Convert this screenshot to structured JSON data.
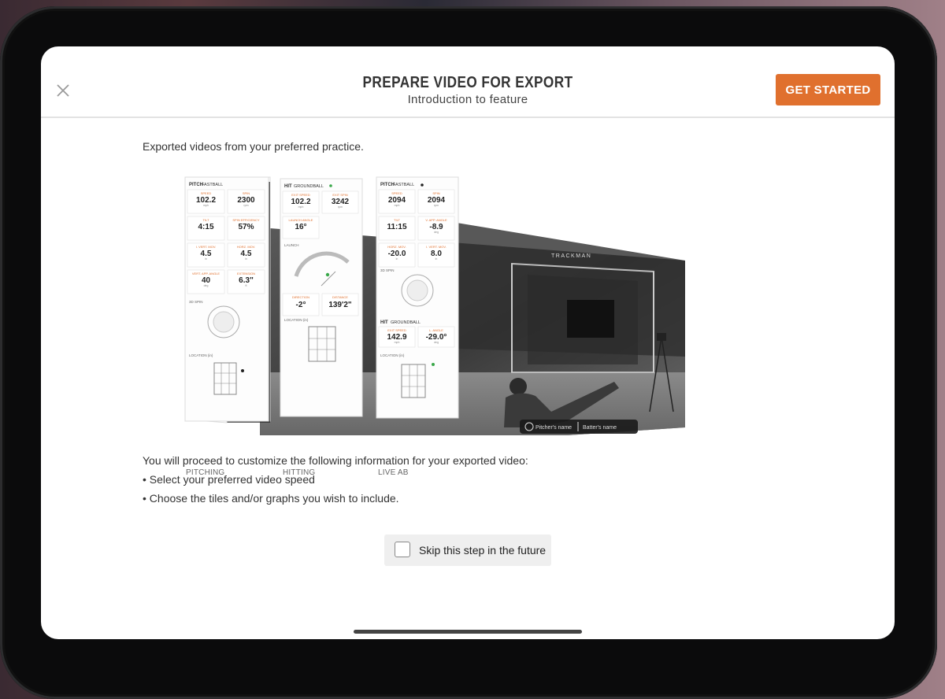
{
  "header": {
    "title": "PREPARE VIDEO FOR EXPORT",
    "subtitle": "Introduction to feature",
    "close_icon": "close-icon",
    "cta_label": "GET STARTED",
    "accent_color": "#e0702e"
  },
  "intro": "Exported videos from your preferred practice.",
  "preview": {
    "captions": [
      "PITCHING",
      "HITTING",
      "LIVE AB"
    ],
    "pitching_panel": {
      "header": "PITCH",
      "header_sub": "FASTBALL",
      "tiles": [
        {
          "label": "SPEED",
          "value": "102.2",
          "unit": "mph"
        },
        {
          "label": "SPIN",
          "value": "2300",
          "unit": "rpm"
        },
        {
          "label": "TILT",
          "value": "4:15",
          "unit": ""
        },
        {
          "label": "SPIN EFFICIENCY",
          "value": "57%",
          "unit": ""
        },
        {
          "label": "I. VERT. MOV.",
          "value": "4.5",
          "unit": "in"
        },
        {
          "label": "HORZ. MOV.",
          "value": "4.5",
          "unit": "in"
        },
        {
          "label": "VERT. APP. ANGLE",
          "value": "40",
          "unit": "deg"
        },
        {
          "label": "EXTENSION",
          "value": "6.3\"",
          "unit": "ft"
        }
      ],
      "spin_label": "3D SPIN",
      "location_label": "LOCATION (in)"
    },
    "hitting_panel": {
      "header": "HIT",
      "header_sub": "GROUNDBALL",
      "tiles": [
        {
          "label": "EXIT SPEED",
          "value": "102.2",
          "unit": "mph"
        },
        {
          "label": "EXIT SPIN",
          "value": "3242",
          "unit": "rpm"
        },
        {
          "label": "LAUNCH ANGLE",
          "value": "16°",
          "unit": ""
        },
        {
          "label": "DIRECTION",
          "value": "-2°",
          "unit": ""
        },
        {
          "label": "DISTANCE",
          "value": "139'2\"",
          "unit": ""
        }
      ],
      "launch_label": "LAUNCH",
      "location_label": "LOCATION (in)"
    },
    "liveab_panel": {
      "header": "PITCH",
      "header_sub": "FASTBALL",
      "tiles": [
        {
          "label": "SPEED",
          "value": "2094",
          "unit": "mph"
        },
        {
          "label": "SPIN",
          "value": "2094",
          "unit": "rpm"
        },
        {
          "label": "TILT",
          "value": "11:15",
          "unit": ""
        },
        {
          "label": "V. APP. ANGLE",
          "value": "-8.9",
          "unit": "deg"
        },
        {
          "label": "HORZ. MOV.",
          "value": "-20.0",
          "unit": "in"
        },
        {
          "label": "I. VERT. MOV.",
          "value": "8.0",
          "unit": "in"
        }
      ],
      "spin_label": "3D SPIN",
      "hit_header": "HIT",
      "hit_header_sub": "GROUNDBALL",
      "hit_tiles": [
        {
          "label": "EXIT SPEED",
          "value": "142.9",
          "unit": "mph"
        },
        {
          "label": "L. ANGLE",
          "value": "-29.0°",
          "unit": "deg"
        }
      ],
      "location_label": "LOCATION (in)"
    },
    "video": {
      "brand": "TRACKMAN",
      "pitcher_tag": "Pitcher's name",
      "batter_tag": "Batter's name"
    }
  },
  "instructions": {
    "lead": "You will proceed to customize the following information for your exported video:",
    "bullets": [
      "• Select your preferred video speed",
      "• Choose the tiles and/or graphs you wish to include."
    ]
  },
  "skip": {
    "label": "Skip this step in the future",
    "checked": false
  }
}
